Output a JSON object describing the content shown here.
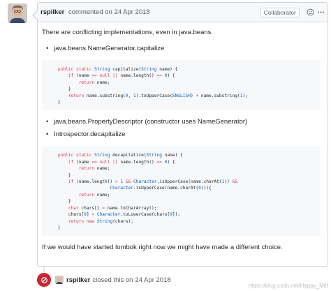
{
  "comment": {
    "author": "rspilker",
    "action": "commented on",
    "date": "24 Apr 2018",
    "badge": "Collaborator",
    "body": {
      "intro": "There are conflicting implementations, even in java.beans.",
      "list1": [
        "java.beans.NameGenerator.capitalize"
      ],
      "code1": "    public static String capitalize(String name) {\n        if (name == null || name.length() == 0) {\n            return name;\n        }\n        return name.substring(0, 1).toUpperCase(ENGLISH) + name.substring(1);\n    }",
      "list2": [
        "java.beans.PropertyDescriptor (constructor uses NameGenerator)",
        "Introspector.decapitalize"
      ],
      "code2": "    public static String decapitalize(String name) {\n        if (name == null || name.length() == 0) {\n            return name;\n        }\n        if (name.length() > 1 && Character.isUpperCase(name.charAt(1)) &&\n                        Character.isUpperCase(name.charAt(0))){\n            return name;\n        }\n        char chars[] = name.toCharArray();\n        chars[0] = Character.toLowerCase(chars[0]);\n        return new String(chars);\n    }",
      "outro": "If we would have started lombok right now we might have made a different choice."
    }
  },
  "event": {
    "author": "rspilker",
    "action": "closed this on",
    "date": "24 Apr 2018"
  },
  "watermark": "https://blog.csdn.net/Happy_Mitt",
  "colors": {
    "closed": "#cb2431",
    "header_bg": "#f6f8fa",
    "border": "#d1d5da"
  },
  "icons": {
    "reaction": "smiley-icon",
    "more": "kebab-icon",
    "closed": "circle-slash-icon"
  }
}
